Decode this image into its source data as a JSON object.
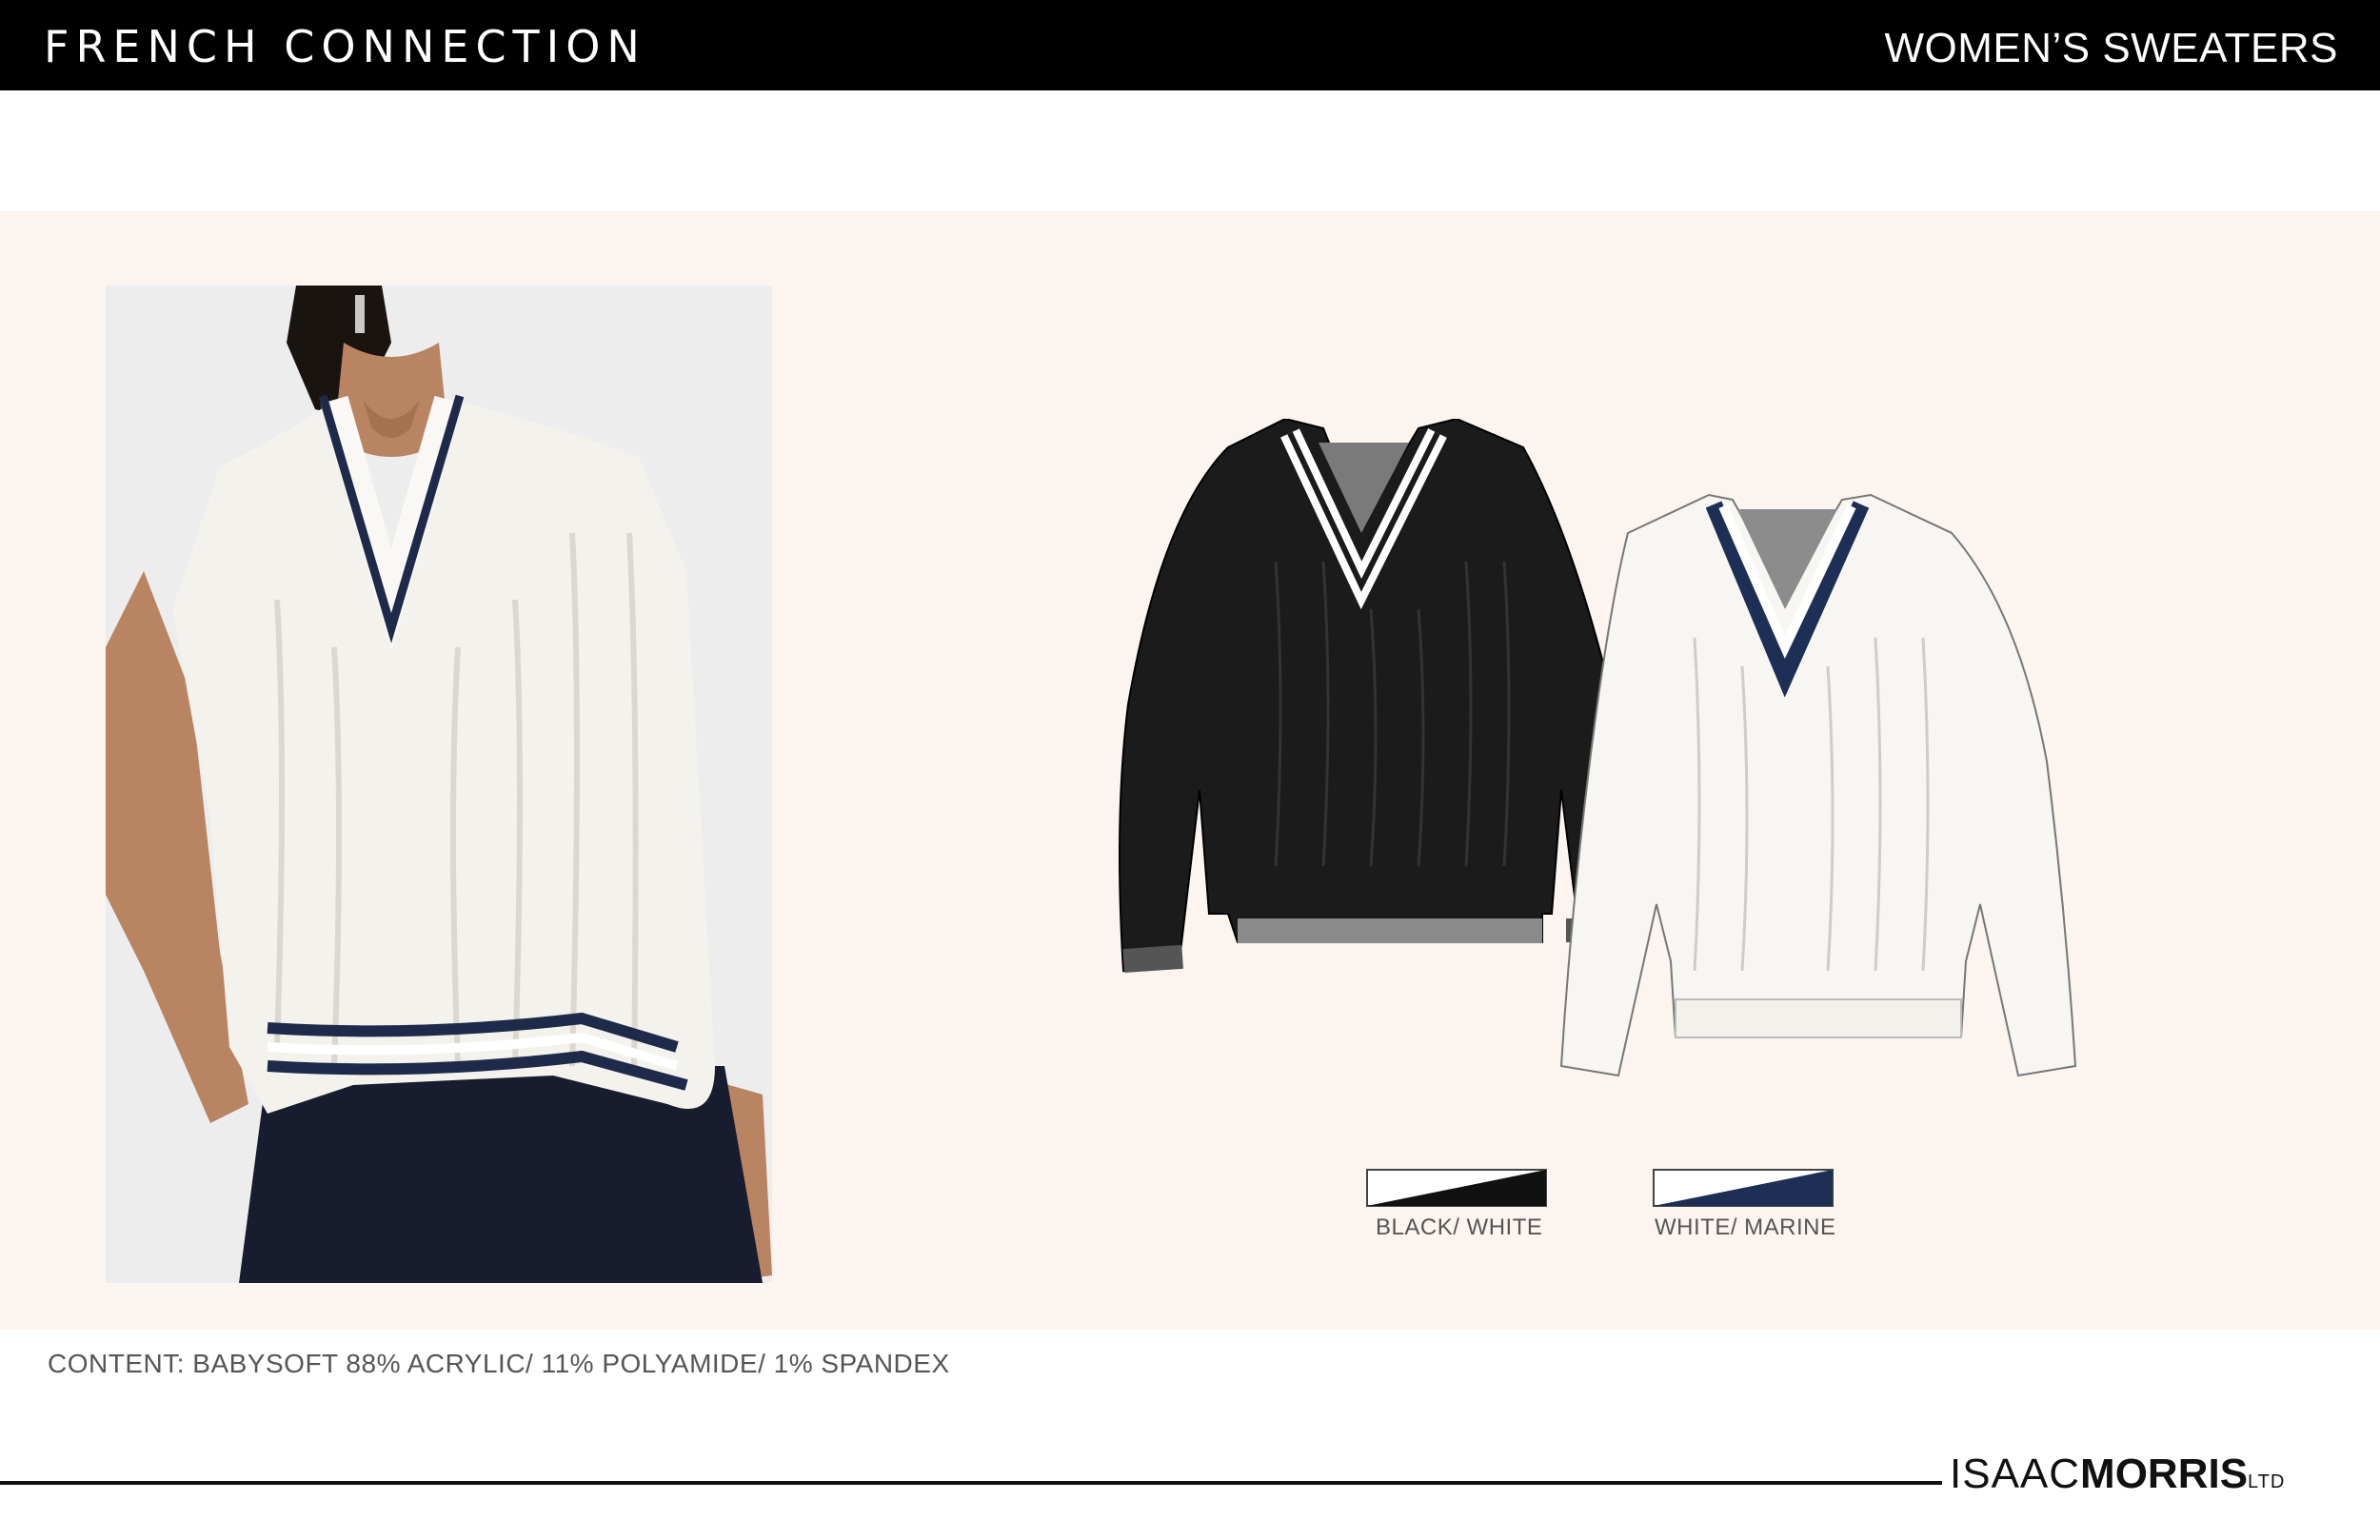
{
  "header": {
    "brand": "FRENCH CONNECTION",
    "category": "WOMEN’S SWEATERS"
  },
  "colors": {
    "header_bg": "#000000",
    "panel_bg": "#fbf4ef",
    "navy": "#1e2a4a",
    "black": "#1b1b1b",
    "ivory": "#f7f6f2"
  },
  "swatches": [
    {
      "label": "BLACK/ WHITE",
      "color_a": "#ffffff",
      "color_b": "#111111"
    },
    {
      "label": "WHITE/ MARINE",
      "color_a": "#ffffff",
      "color_b": "#1e2f55"
    }
  ],
  "content": "CONTENT: BABYSOFT 88% ACRYLIC/ 11% POLYAMIDE/ 1% SPANDEX",
  "logo": {
    "light": "ISAAC",
    "bold": "MORRIS",
    "suffix": "LTD"
  }
}
